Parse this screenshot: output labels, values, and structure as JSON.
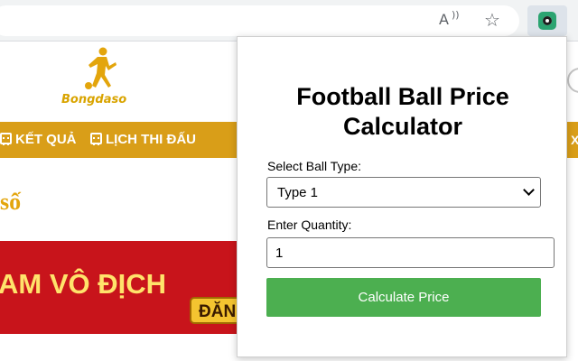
{
  "browser": {
    "toolbar_icons": [
      "read-aloud-icon",
      "favorite-star-icon",
      "extension-icon"
    ]
  },
  "website": {
    "logo_text": "Bongdaso",
    "nav": {
      "ket_qua": "KẾT QUẢ",
      "lich_thi_dau": "LỊCH THI ĐẤU",
      "partial": "X"
    },
    "heading_fragment": "số",
    "banner": {
      "text": "AM VÔ ĐỊCH",
      "button": "ĐĂN"
    },
    "colors": {
      "nav": "#d99e18",
      "banner": "#c8141b",
      "heading": "#e3a50c"
    }
  },
  "popup": {
    "title": "Football Ball Price Calculator",
    "ball_type_label": "Select Ball Type:",
    "ball_type_value": "Type 1",
    "quantity_label": "Enter Quantity:",
    "quantity_value": "1",
    "calculate_label": "Calculate Price",
    "colors": {
      "button": "#4caf50"
    }
  }
}
